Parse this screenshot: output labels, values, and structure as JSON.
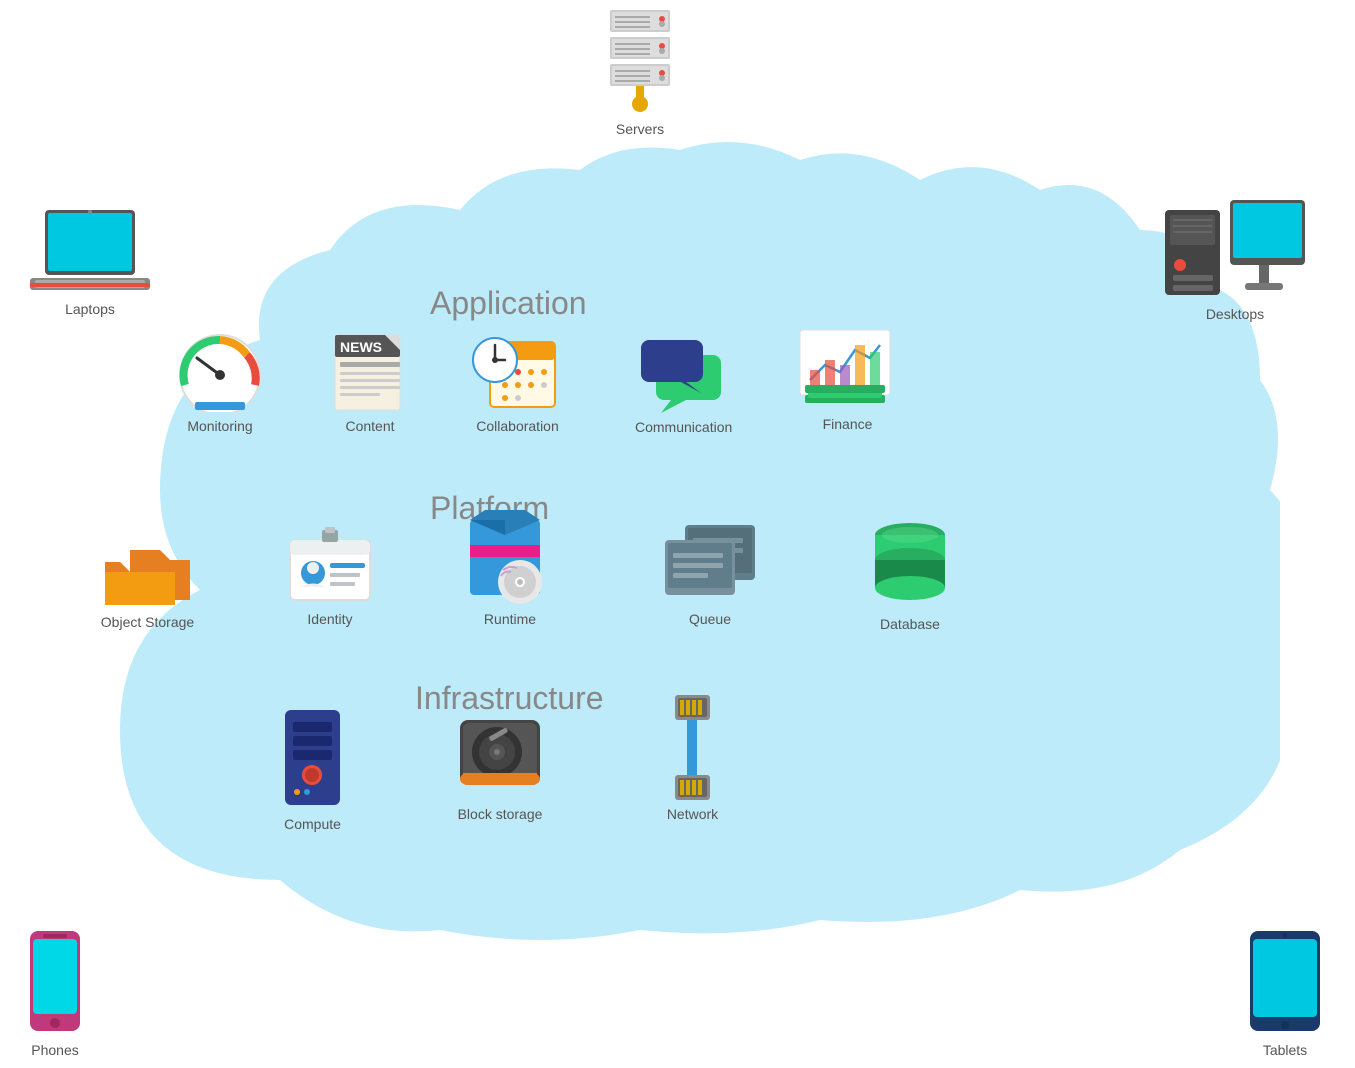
{
  "sections": {
    "application": "Application",
    "platform": "Platform",
    "infrastructure": "Infrastructure"
  },
  "items": {
    "servers": {
      "label": "Servers"
    },
    "laptops": {
      "label": "Laptops"
    },
    "desktops": {
      "label": "Desktops"
    },
    "phones": {
      "label": "Phones"
    },
    "tablets": {
      "label": "Tablets"
    },
    "monitoring": {
      "label": "Monitoring"
    },
    "content": {
      "label": "Content"
    },
    "collaboration": {
      "label": "Collaboration"
    },
    "communication": {
      "label": "Communication"
    },
    "finance": {
      "label": "Finance"
    },
    "identity": {
      "label": "Identity"
    },
    "object_storage": {
      "label": "Object Storage"
    },
    "runtime": {
      "label": "Runtime"
    },
    "queue": {
      "label": "Queue"
    },
    "database": {
      "label": "Database"
    },
    "compute": {
      "label": "Compute"
    },
    "block_storage": {
      "label": "Block storage"
    },
    "network": {
      "label": "Network"
    }
  }
}
